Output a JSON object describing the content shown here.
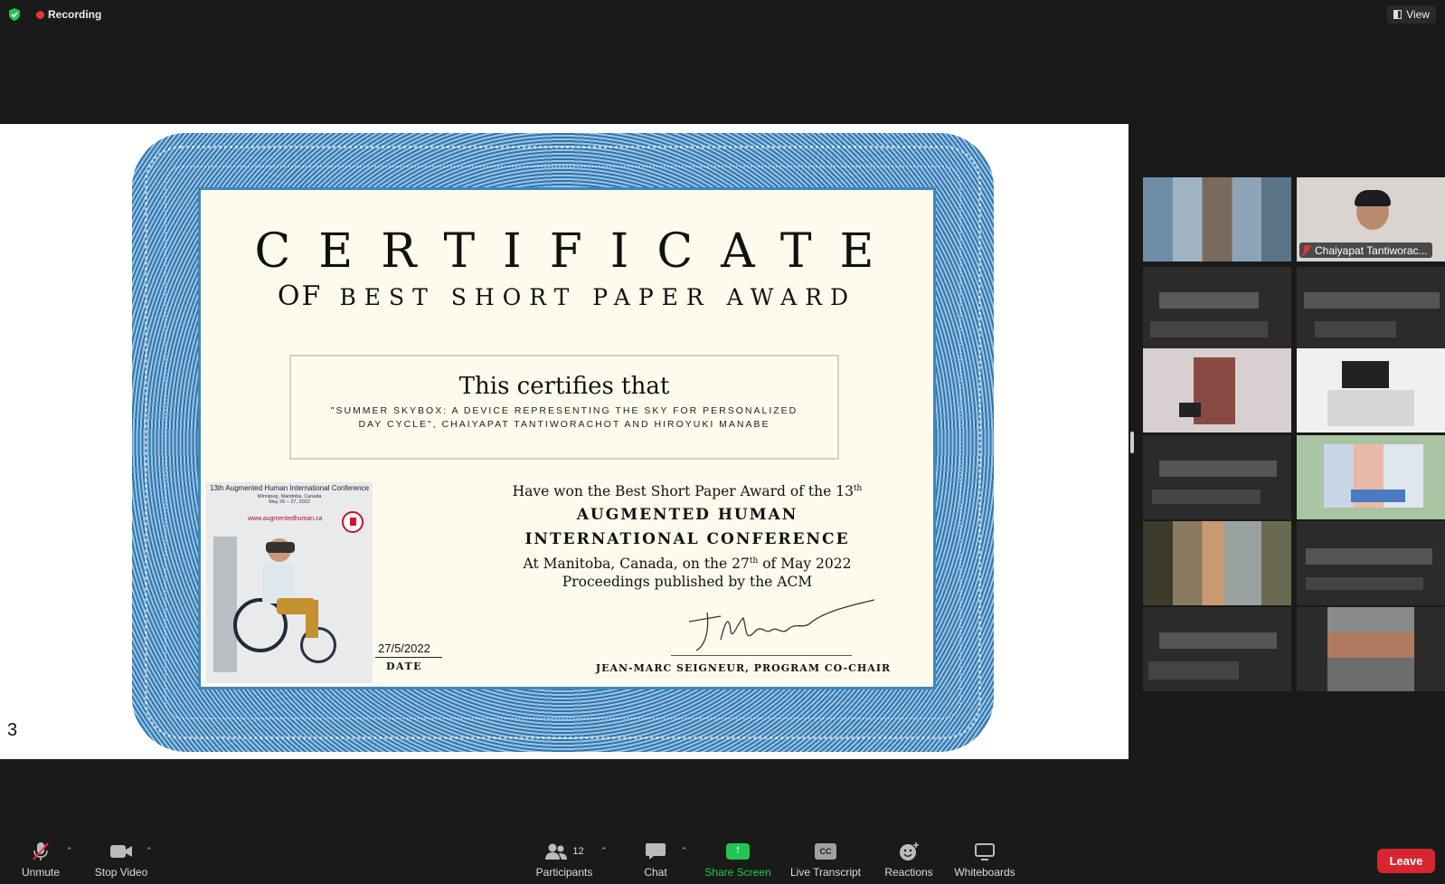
{
  "top_bar": {
    "recording_label": "Recording",
    "view_label": "View"
  },
  "shared_screen": {
    "page_number": "3",
    "certificate": {
      "title": "CERTIFICATE",
      "of": "OF",
      "award": "BEST SHORT PAPER AWARD",
      "certifies": "This certifies that",
      "work": "\"SUMMER SKYBOX: A DEVICE REPRESENTING THE SKY FOR PERSONALIZED DAY CYCLE\", CHAIYAPAT TANTIWORACHOT AND HIROYUKI MANABE",
      "won_prefix": "Have won the Best Short Paper Award of the 13",
      "won_sup": "th",
      "conf_line1": "AUGMENTED HUMAN",
      "conf_line2": "INTERNATIONAL CONFERENCE",
      "at_prefix": "At Manitoba, Canada, on the 27",
      "at_sup": "th",
      "at_suffix": " of May 2022",
      "proceedings": "Proceedings published by the ACM",
      "date_value": "27/5/2022",
      "date_label": "DATE",
      "signer": "JEAN-MARC SEIGNEUR, PROGRAM CO-CHAIR",
      "poster": {
        "header": "13th Augmented Human International Conference",
        "location": "Winnipeg, Manitoba, Canada",
        "dates": "May 26 – 27, 2022",
        "url": "www.augmentedhuman.ca"
      }
    }
  },
  "gallery": {
    "named_participant": "Chaiyapat Tantiworac..."
  },
  "toolbar": {
    "unmute": "Unmute",
    "stop_video": "Stop Video",
    "participants": "Participants",
    "participants_count": "12",
    "chat": "Chat",
    "share_screen": "Share Screen",
    "live_transcript": "Live Transcript",
    "cc": "CC",
    "reactions": "Reactions",
    "whiteboards": "Whiteboards",
    "leave": "Leave"
  },
  "colors": {
    "leave": "#d7262f",
    "share_screen": "#23c552",
    "recording_dot": "#e8363c",
    "certificate_border": "#2f76ad"
  }
}
